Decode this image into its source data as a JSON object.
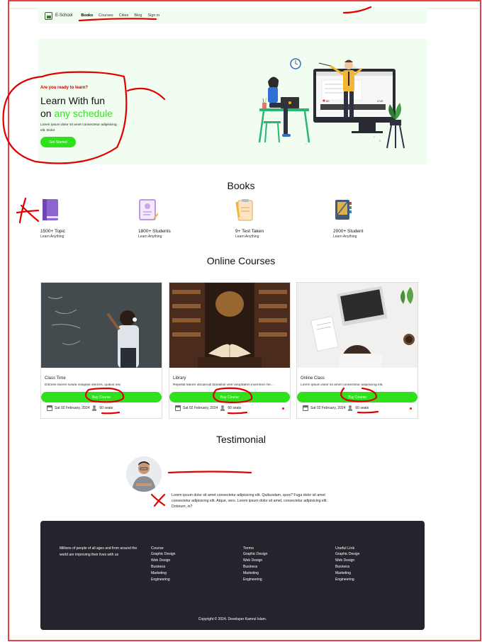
{
  "nav": {
    "logo_text": "E-School",
    "links": [
      "Books",
      "Courses",
      "Cities",
      "Blog",
      "Sign in"
    ]
  },
  "hero": {
    "kicker": "Are you ready to learn?",
    "title_line1": "Learn With fun",
    "title_line2_prefix": "on ",
    "title_line2_accent": "any schedule",
    "text": "Lorem ipsum dolor sit amet consectetur adipisicing elit. Dolor",
    "button": "Get Started",
    "illustration_badge_left": "80",
    "illustration_badge_right": "LIVE"
  },
  "books": {
    "title": "Books",
    "stats": [
      {
        "title": "1500+ Topic",
        "sub": "Learn Anything"
      },
      {
        "title": "1800+ Students",
        "sub": "Learn Anything"
      },
      {
        "title": "9+ Test Taken",
        "sub": "Learn Anything"
      },
      {
        "title": "2000+ Student",
        "sub": "Learn Anything"
      }
    ]
  },
  "courses": {
    "title": "Online Courses",
    "items": [
      {
        "title": "Class Time",
        "desc": "Dolores facere soluta voluptas dolores, quibus nisi",
        "button": "Buy Course",
        "date": "Sat 02 February, 2024",
        "seats": "60 seats"
      },
      {
        "title": "Library",
        "desc": "Repellat labore obcaecati blanditiis velit voluptatem inventore me...",
        "button": "Buy Course",
        "date": "Sat 02 February, 2024",
        "seats": "60 seats"
      },
      {
        "title": "Online Class",
        "desc": "Lorem ipsum dolor sit amet consectetur adipisicing elit.",
        "button": "Buy Course",
        "date": "Sat 02 February, 2024",
        "seats": "60 seats"
      }
    ]
  },
  "testimonial": {
    "title": "Testimonial",
    "text": "Lorem ipsum dolor sit amet consectetur adipisicing elit. Quibusdam, quos? Fuga dolor sit amet consectetur adipisicing elit. Atque, vero. Lorem ipsum dolor sit amet, consectetur adipisicing elit. Dolorum, in?"
  },
  "footer": {
    "about": "Millions of people of all ages and from around the world are improving their lives with us",
    "columns": [
      {
        "title": "Course",
        "items": [
          "Graphic Design",
          "Web Design",
          "Business",
          "Marketing",
          "Engineering"
        ]
      },
      {
        "title": "Terms",
        "items": [
          "Graphic Design",
          "Web Design",
          "Business",
          "Marketing",
          "Engineering"
        ]
      },
      {
        "title": "Useful Link",
        "items": [
          "Graphic Design",
          "Web Design",
          "Business",
          "Marketing",
          "Engineering"
        ]
      }
    ],
    "copyright": "Copyright © 2024. Developer Kamrul Islam."
  },
  "colors": {
    "accent_green": "#2fe01c",
    "hero_bg": "#f0fdf0",
    "footer_bg": "#25232b",
    "annotation_red": "#e00000"
  }
}
